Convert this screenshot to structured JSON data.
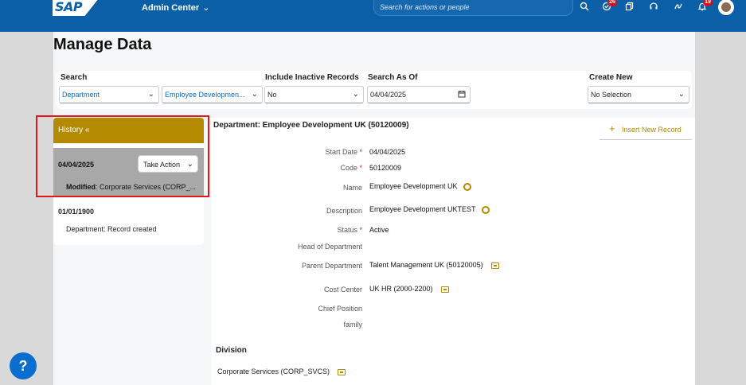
{
  "shell": {
    "logo_text": "SAP",
    "app_title": "Admin Center",
    "search_placeholder": "Search for actions or people",
    "todo_badge": "26",
    "notif_badge": "19"
  },
  "page": {
    "title": "Manage Data"
  },
  "filters": {
    "search_label": "Search",
    "search_type_value": "Department",
    "search_target_value": "Employee Developmen...",
    "inactive_label": "Include Inactive Records",
    "inactive_value": "No",
    "asof_label": "Search As Of",
    "asof_value": "04/04/2025",
    "create_label": "Create New",
    "create_value": "No Selection"
  },
  "history": {
    "header": "History «",
    "selected_date": "04/04/2025",
    "take_action": "Take Action",
    "modified_label": "Modified",
    "modified_value": ": Corporate Services (CORP_...",
    "old_date": "01/01/1900",
    "old_desc": "Department: Record created"
  },
  "detail": {
    "title": "Department: Employee Development UK (50120009)",
    "insert_label": "Insert New Record",
    "fields": {
      "start_date_label": "Start Date",
      "start_date_value": "04/04/2025",
      "code_label": "Code",
      "code_value": "50120009",
      "name_label": "Name",
      "name_value": "Employee Development UK",
      "description_label": "Description",
      "description_value": "Employee Development UKTEST",
      "status_label": "Status",
      "status_value": "Active",
      "head_label": "Head of Department",
      "parent_label": "Parent Department",
      "parent_value": "Talent Management UK (50120005)",
      "cost_label": "Cost Center",
      "cost_value": "UK HR (2000-2200)",
      "chief_label": "Chief Position",
      "family_label": "family",
      "required_mark": "*"
    },
    "division_header": "Division",
    "division_value": "Corporate Services (CORP_SVCS)"
  },
  "help_label": "?",
  "colors": {
    "shell": "#0a5fa7",
    "accent_gold": "#b48a00",
    "highlight_red": "#e0171f"
  }
}
